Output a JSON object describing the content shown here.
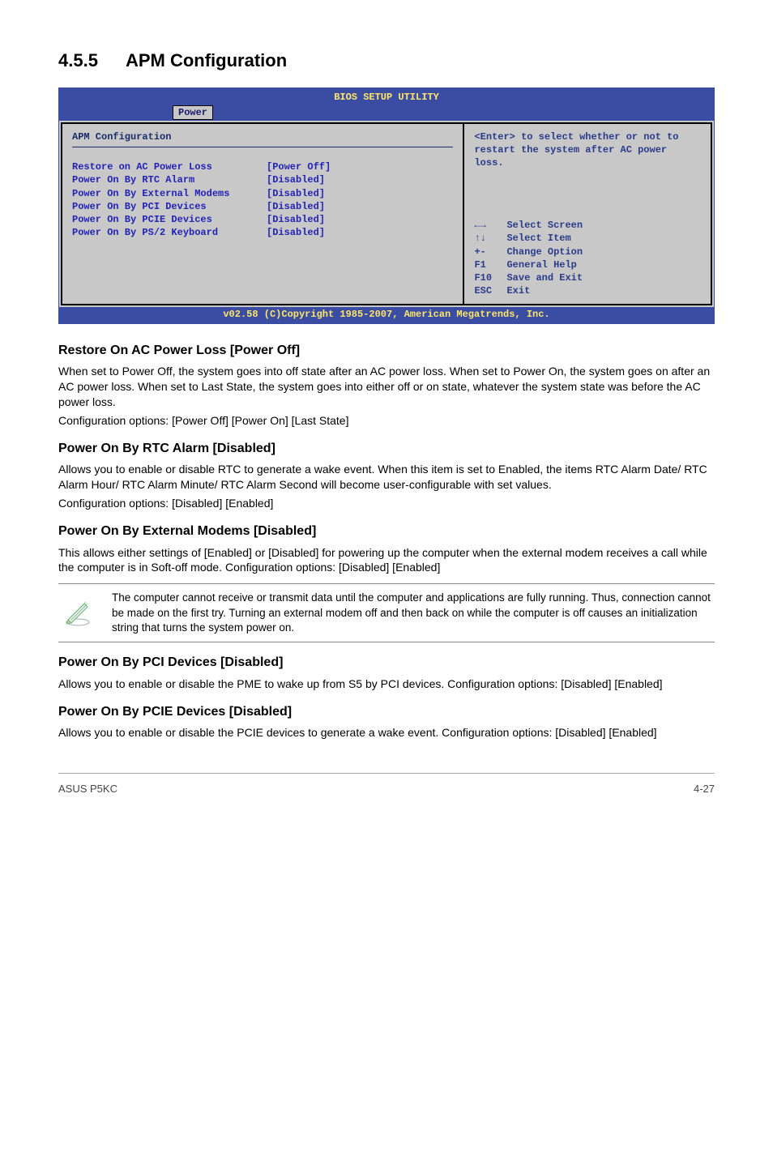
{
  "section": {
    "number": "4.5.5",
    "title": "APM Configuration"
  },
  "bios": {
    "title": "BIOS SETUP UTILITY",
    "tab": "Power",
    "heading": "APM Configuration",
    "rows": [
      {
        "label": "Restore on AC Power Loss",
        "value": "[Power Off]"
      },
      {
        "label": "Power On By RTC Alarm",
        "value": "[Disabled]"
      },
      {
        "label": "Power On By External Modems",
        "value": "[Disabled]"
      },
      {
        "label": "Power On By PCI Devices",
        "value": "[Disabled]"
      },
      {
        "label": "Power On By PCIE Devices",
        "value": "[Disabled]"
      },
      {
        "label": "Power On By PS/2 Keyboard",
        "value": "[Disabled]"
      }
    ],
    "help_top": "<Enter> to select whether or not to restart the system after AC power loss.",
    "help_keys": [
      {
        "key": "←→",
        "desc": "Select Screen"
      },
      {
        "key": "↑↓",
        "desc": "Select Item"
      },
      {
        "key": "+-",
        "desc": "Change Option"
      },
      {
        "key": "F1",
        "desc": "General Help"
      },
      {
        "key": "F10",
        "desc": "Save and Exit"
      },
      {
        "key": "ESC",
        "desc": "Exit"
      }
    ],
    "footer": "v02.58 (C)Copyright 1985-2007, American Megatrends, Inc."
  },
  "settings": [
    {
      "heading": "Restore On AC Power Loss [Power Off]",
      "paragraphs": [
        "When set to Power Off, the system goes into off state after an AC power loss. When set to Power On, the system goes on after an AC power loss. When set to Last State, the system goes into either off or on state, whatever the system state was before the AC power loss.",
        "Configuration options: [Power Off] [Power On] [Last State]"
      ]
    },
    {
      "heading": "Power On By RTC Alarm [Disabled]",
      "paragraphs": [
        "Allows you to enable or disable RTC to generate a wake event. When this item is set to Enabled, the items RTC Alarm Date/ RTC Alarm Hour/ RTC Alarm Minute/ RTC Alarm Second will become user-configurable with set values.",
        "Configuration options: [Disabled] [Enabled]"
      ]
    },
    {
      "heading": "Power On By External Modems [Disabled]",
      "paragraphs": [
        "This allows either settings of [Enabled] or [Disabled] for powering up the computer when the external modem receives a call while the computer is in Soft-off mode. Configuration options: [Disabled] [Enabled]"
      ]
    }
  ],
  "note": "The computer cannot receive or transmit data until the computer and applications are fully running. Thus, connection cannot be made on the first try. Turning an external modem off and then back on while the computer is off causes an initialization string that turns the system power on.",
  "settings_after_note": [
    {
      "heading": "Power On By PCI Devices [Disabled]",
      "paragraphs": [
        "Allows you to enable or disable the PME to wake up from S5 by PCI devices. Configuration options: [Disabled] [Enabled]"
      ]
    },
    {
      "heading": "Power On By PCIE Devices [Disabled]",
      "paragraphs": [
        "Allows you to enable or disable the PCIE devices to generate a wake event. Configuration options: [Disabled] [Enabled]"
      ]
    }
  ],
  "footer": {
    "left": "ASUS P5KC",
    "right": "4-27"
  }
}
